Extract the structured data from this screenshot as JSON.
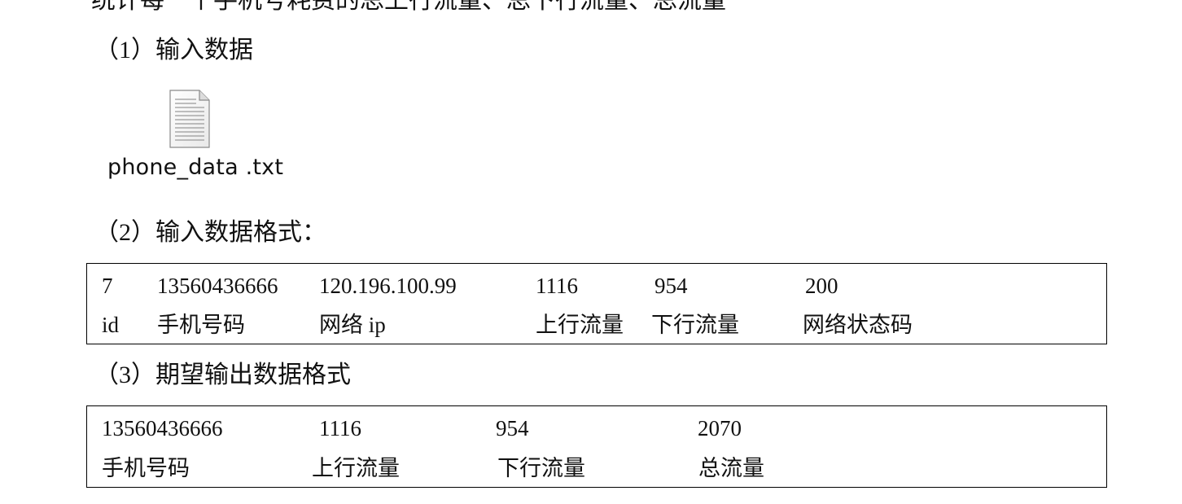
{
  "cut_off_line": "统计每一个手机号耗费的总上行流量、总下行流量、总流量",
  "section1": {
    "heading": "（1）输入数据",
    "file": {
      "icon": "text-file-icon",
      "name": "phone_data .txt"
    }
  },
  "section2": {
    "heading": "（2）输入数据格式：",
    "table": {
      "values": [
        "7",
        "13560436666",
        "120.196.100.99",
        "1116",
        "954",
        "200"
      ],
      "labels": [
        "id",
        "手机号码",
        "网络 ip",
        "上行流量",
        "下行流量",
        "网络状态码"
      ]
    }
  },
  "section3": {
    "heading": "（3）期望输出数据格式",
    "table": {
      "values": [
        "13560436666",
        "1116",
        "954",
        "2070"
      ],
      "labels": [
        "手机号码",
        "上行流量",
        "下行流量",
        "总流量"
      ]
    }
  }
}
